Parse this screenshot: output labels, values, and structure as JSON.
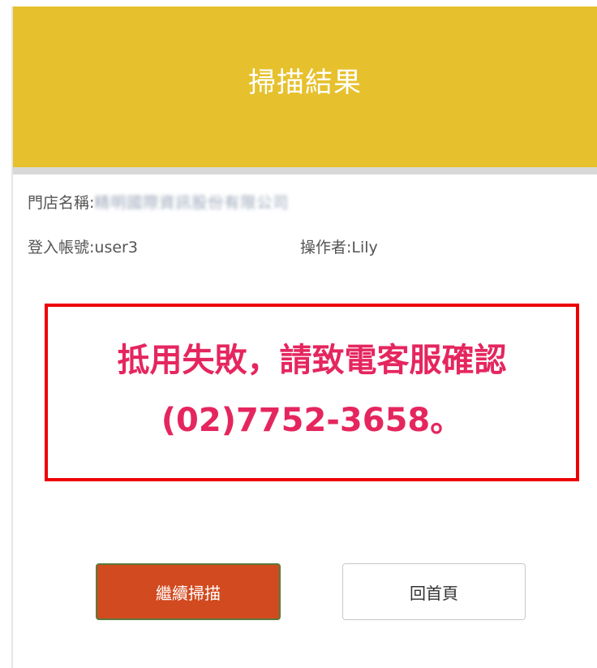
{
  "header": {
    "title": "掃描結果"
  },
  "info": {
    "store_label": "門店名稱:",
    "store_value": "精明國際資訊股份有限公司",
    "login_label": "登入帳號:",
    "login_value": "user3",
    "operator_label": "操作者:",
    "operator_value": "Lily"
  },
  "alert": {
    "message": "抵用失敗，請致電客服確認(02)7752-3658。"
  },
  "buttons": {
    "continue_label": "繼續掃描",
    "home_label": "回首頁"
  },
  "colors": {
    "header_bg": "#e6c12d",
    "alert_border": "#ee0000",
    "alert_text": "#e5265e",
    "continue_bg": "#d24a1f"
  }
}
